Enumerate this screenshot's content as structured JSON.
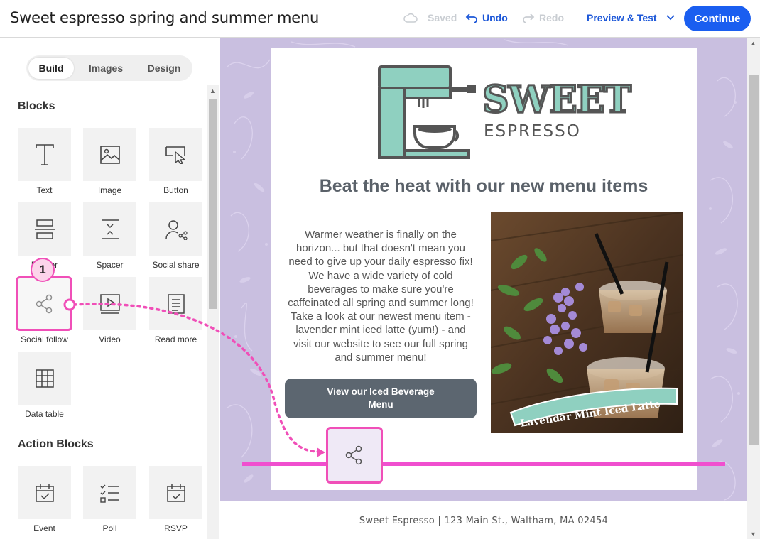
{
  "header": {
    "title": "Sweet espresso spring and summer menu",
    "saved_label": "Saved",
    "undo_label": "Undo",
    "redo_label": "Redo",
    "preview_label": "Preview & Test",
    "continue_label": "Continue"
  },
  "sidebar": {
    "tabs": [
      {
        "label": "Build",
        "active": true
      },
      {
        "label": "Images",
        "active": false
      },
      {
        "label": "Design",
        "active": false
      }
    ],
    "blocks_heading": "Blocks",
    "blocks": [
      {
        "label": "Text",
        "icon": "text-icon"
      },
      {
        "label": "Image",
        "icon": "image-icon"
      },
      {
        "label": "Button",
        "icon": "button-icon"
      },
      {
        "label": "Divider",
        "icon": "divider-icon"
      },
      {
        "label": "Spacer",
        "icon": "spacer-icon"
      },
      {
        "label": "Social share",
        "icon": "social-share-icon"
      },
      {
        "label": "Social follow",
        "icon": "share-icon"
      },
      {
        "label": "Video",
        "icon": "video-icon"
      },
      {
        "label": "Read more",
        "icon": "read-more-icon"
      },
      {
        "label": "Data table",
        "icon": "table-icon"
      }
    ],
    "action_heading": "Action Blocks",
    "action_blocks": [
      {
        "label": "Event",
        "icon": "calendar-icon"
      },
      {
        "label": "Poll",
        "icon": "poll-icon"
      },
      {
        "label": "RSVP",
        "icon": "rsvp-icon"
      }
    ],
    "step_badge": "1"
  },
  "email": {
    "logo_word": "SWEET",
    "logo_sub": "ESPRESSO",
    "headline": "Beat the heat with our new menu items",
    "body": "Warmer weather is finally on the horizon... but that doesn't mean you need to give up your daily espresso fix! We have a wide variety of cold beverages to make sure you're caffeinated all spring and summer long! Take a look at our newest menu item - lavender mint iced latte (yum!) - and visit our website to see our full spring and summer menu!",
    "cta_label": "View our Iced Beverage Menu",
    "photo_banner": "Lavendar Mint Iced Latte",
    "footer": "Sweet Espresso | 123 Main St., Waltham, MA 02454"
  },
  "colors": {
    "accent": "#1a5ef0",
    "highlight": "#f04fb8",
    "canvas_bg": "#c9bfe0",
    "logo_teal": "#8fd0c0"
  }
}
